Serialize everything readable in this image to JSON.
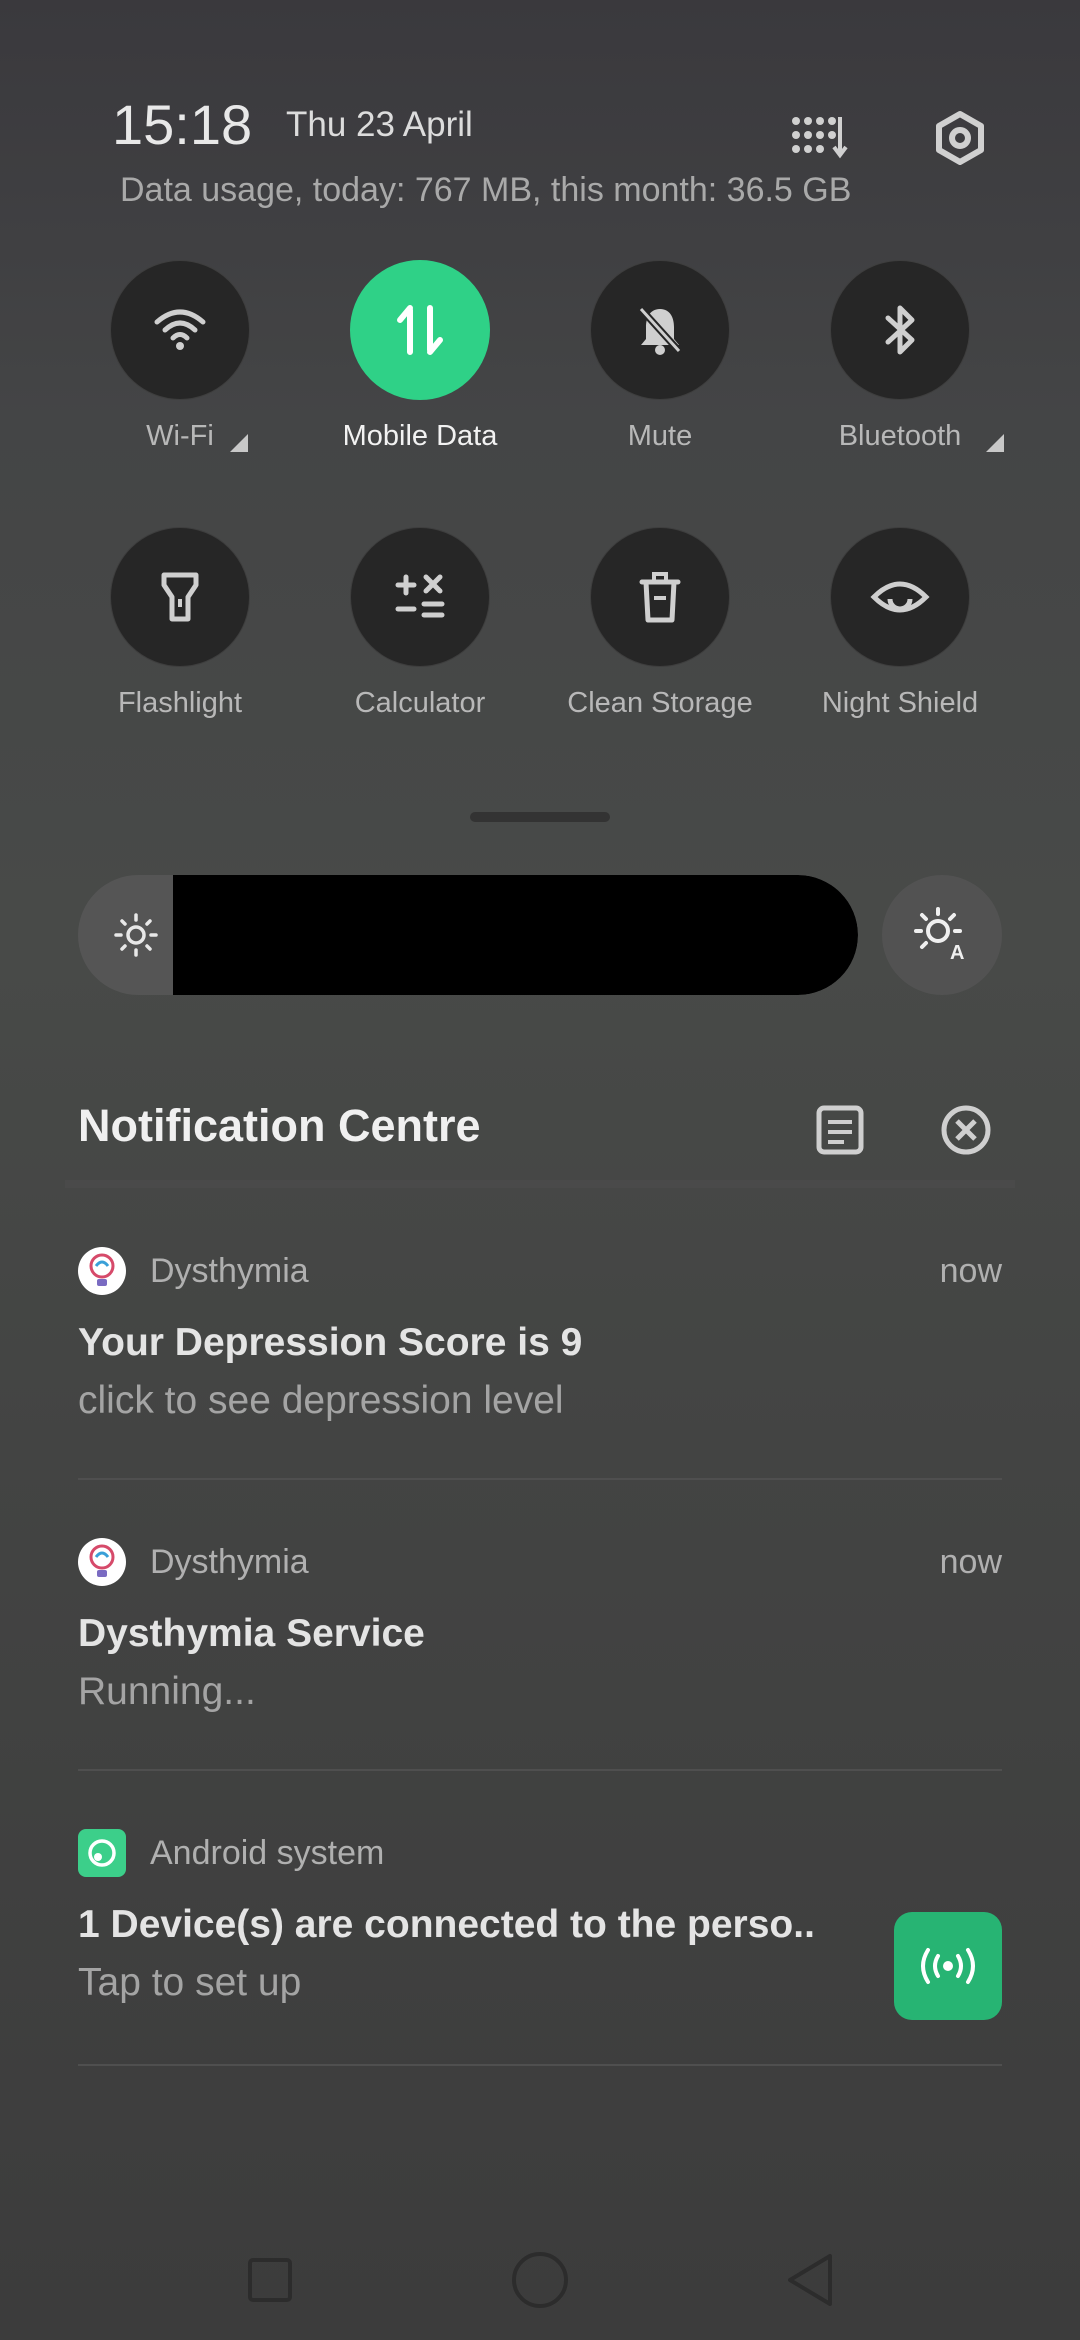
{
  "status": {
    "time": "15:18",
    "date": "Thu 23 April",
    "data_usage": "Data usage, today: 767 MB, this month: 36.5 GB"
  },
  "quick_settings": {
    "tiles": [
      {
        "label": "Wi-Fi",
        "icon": "wifi-icon",
        "active": false,
        "expandable": true
      },
      {
        "label": "Mobile Data",
        "icon": "mobile-data-icon",
        "active": true,
        "expandable": false
      },
      {
        "label": "Mute",
        "icon": "mute-bell-icon",
        "active": false,
        "expandable": false
      },
      {
        "label": "Bluetooth",
        "icon": "bluetooth-icon",
        "active": false,
        "expandable": true
      },
      {
        "label": "Flashlight",
        "icon": "flashlight-icon",
        "active": false,
        "expandable": false
      },
      {
        "label": "Calculator",
        "icon": "calculator-icon",
        "active": false,
        "expandable": false
      },
      {
        "label": "Clean Storage",
        "icon": "trash-icon",
        "active": false,
        "expandable": false
      },
      {
        "label": "Night Shield",
        "icon": "eye-icon",
        "active": false,
        "expandable": false
      }
    ]
  },
  "notification_centre": {
    "title": "Notification Centre",
    "notifications": [
      {
        "app": "Dysthymia",
        "time": "now",
        "title": "Your Depression Score is 9",
        "body": "click to see depression level"
      },
      {
        "app": "Dysthymia",
        "time": "now",
        "title": "Dysthymia Service",
        "body": "Running..."
      },
      {
        "app": "Android system",
        "time": "",
        "title": "1 Device(s) are connected to the perso..",
        "body": "Tap to set up"
      }
    ]
  },
  "colors": {
    "accent": "#2fd187",
    "tile_bg": "#262626",
    "hotspot": "#27b473"
  }
}
